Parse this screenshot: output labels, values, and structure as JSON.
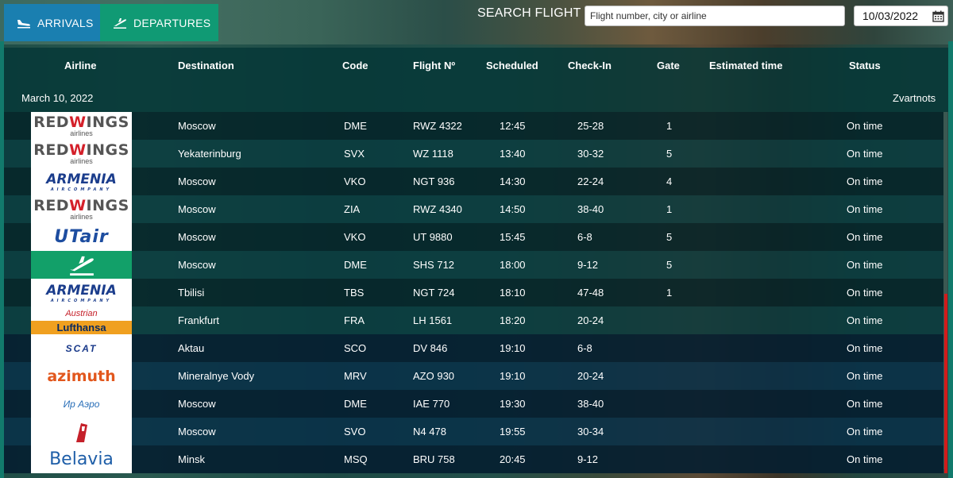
{
  "tabs": {
    "arrivals": "ARRIVALS",
    "departures": "DEPARTURES",
    "active": "departures"
  },
  "search": {
    "label": "SEARCH FLIGHT",
    "placeholder": "Flight number, city or airline",
    "date": "10/03/2022"
  },
  "table": {
    "headers": {
      "airline": "Airline",
      "destination": "Destination",
      "code": "Code",
      "flight": "Flight Nº",
      "scheduled": "Scheduled",
      "checkin": "Check-In",
      "gate": "Gate",
      "estimated": "Estimated time",
      "status": "Status"
    },
    "date_label": "March 10, 2022",
    "airport": "Zvartnots",
    "rows": [
      {
        "logo": "RED WINGS|airlines",
        "destination": "Moscow",
        "code": "DME",
        "flight": "RWZ 4322",
        "scheduled": "12:45",
        "checkin": "25-28",
        "gate": "1",
        "estimated": "",
        "status": "On time"
      },
      {
        "logo": "RED WINGS|airlines",
        "destination": "Yekaterinburg",
        "code": "SVX",
        "flight": "WZ 1118",
        "scheduled": "13:40",
        "checkin": "30-32",
        "gate": "5",
        "estimated": "",
        "status": "On time"
      },
      {
        "logo": "ARMENIA|AIRCOMPANY",
        "destination": "Moscow",
        "code": "VKO",
        "flight": "NGT 936",
        "scheduled": "14:30",
        "checkin": "22-24",
        "gate": "4",
        "estimated": "",
        "status": "On time"
      },
      {
        "logo": "RED WINGS|airlines",
        "destination": "Moscow",
        "code": "ZIA",
        "flight": "RWZ 4340",
        "scheduled": "14:50",
        "checkin": "38-40",
        "gate": "1",
        "estimated": "",
        "status": "On time"
      },
      {
        "logo": "UTair",
        "destination": "Moscow",
        "code": "VKO",
        "flight": "UT 9880",
        "scheduled": "15:45",
        "checkin": "6-8",
        "gate": "5",
        "estimated": "",
        "status": "On time"
      },
      {
        "logo": "",
        "destination": "Moscow",
        "code": "DME",
        "flight": "SHS 712",
        "scheduled": "18:00",
        "checkin": "9-12",
        "gate": "5",
        "estimated": "",
        "status": "On time"
      },
      {
        "logo": "ARMENIA|AIRCOMPANY",
        "destination": "Tbilisi",
        "code": "TBS",
        "flight": "NGT 724",
        "scheduled": "18:10",
        "checkin": "47-48",
        "gate": "1",
        "estimated": "",
        "status": "On time"
      },
      {
        "logo": "Austrian|Lufthansa",
        "destination": "Frankfurt",
        "code": "FRA",
        "flight": "LH 1561",
        "scheduled": "18:20",
        "checkin": "20-24",
        "gate": "",
        "estimated": "",
        "status": "On time"
      },
      {
        "logo": "AIR COMPANY|SCAT",
        "destination": "Aktau",
        "code": "SCO",
        "flight": "DV 846",
        "scheduled": "19:10",
        "checkin": "6-8",
        "gate": "",
        "estimated": "",
        "status": "On time"
      },
      {
        "logo": "azimuth",
        "destination": "Mineralnye Vody",
        "code": "MRV",
        "flight": "AZO 930",
        "scheduled": "19:10",
        "checkin": "20-24",
        "gate": "",
        "estimated": "",
        "status": "On time"
      },
      {
        "logo": "Ир Аэро",
        "destination": "Moscow",
        "code": "DME",
        "flight": "IAE 770",
        "scheduled": "19:30",
        "checkin": "38-40",
        "gate": "",
        "estimated": "",
        "status": "On time"
      },
      {
        "logo": "nordwind airlines",
        "destination": "Moscow",
        "code": "SVO",
        "flight": "N4 478",
        "scheduled": "19:55",
        "checkin": "30-34",
        "gate": "",
        "estimated": "",
        "status": "On time"
      },
      {
        "logo": "Belavia|Belarusian Airlines",
        "destination": "Minsk",
        "code": "MSQ",
        "flight": "BRU 758",
        "scheduled": "20:45",
        "checkin": "9-12",
        "gate": "",
        "estimated": "",
        "status": "On time"
      }
    ]
  },
  "colors": {
    "arrivals_tab": "#1a7fb0",
    "departures_tab": "#109a74",
    "frame": "#127a6c",
    "scroll_indicator": "#d21b1b"
  },
  "icons": {
    "arrivals": "plane-landing-icon",
    "departures": "plane-takeoff-icon",
    "date": "calendar-icon"
  }
}
